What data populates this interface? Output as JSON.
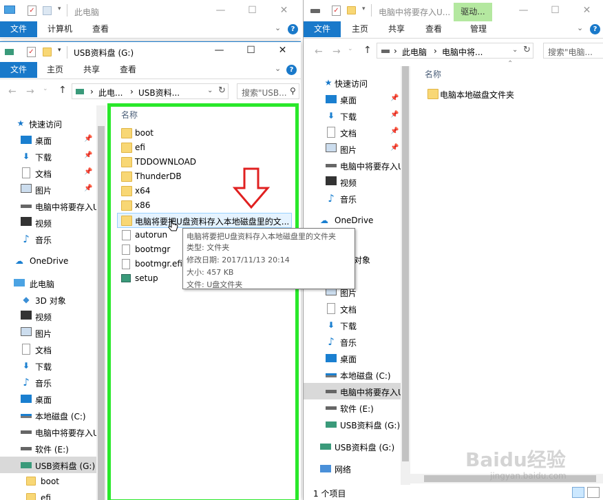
{
  "colors": {
    "accent": "#1979ca",
    "highlight": "#29e82a",
    "selection": "#cce8ff",
    "arrow": "#e02020",
    "drive_tab": "#b4e8a0"
  },
  "back_window": {
    "title": "此电脑",
    "tabs": [
      "文件",
      "计算机",
      "查看"
    ]
  },
  "usb_window": {
    "title": "USB资料盘 (G:)",
    "tabs": [
      "文件",
      "主页",
      "共享",
      "查看"
    ],
    "address": [
      "此电...",
      "USB资料..."
    ],
    "search_placeholder": "搜索\"USB...",
    "column_header": "名称",
    "nav": {
      "quick_access": "快速访问",
      "quick_items": [
        "桌面",
        "下载",
        "文档",
        "图片",
        "电脑中将要存入U",
        "视频",
        "音乐"
      ],
      "onedrive": "OneDrive",
      "this_pc": "此电脑",
      "pc_items": [
        "3D 对象",
        "视频",
        "图片",
        "文档",
        "下载",
        "音乐",
        "桌面",
        "本地磁盘 (C:)",
        "电脑中将要存入U",
        "软件 (E:)",
        "USB资料盘 (G:)",
        "boot",
        "efi"
      ]
    },
    "files": [
      "boot",
      "efi",
      "TDDOWNLOAD",
      "ThunderDB",
      "x64",
      "x86",
      "电脑将要把U盘资料存入本地磁盘里的文...",
      "autorun",
      "bootmgr",
      "bootmgr.efi",
      "setup"
    ],
    "tooltip": [
      "电脑将要把U盘资料存入本地磁盘里的文件夹",
      "类型: 文件夹",
      "修改日期: 2017/11/13 20:14",
      "大小: 457 KB",
      "文件: U盘文件夹"
    ]
  },
  "right_window": {
    "title": "电脑中将要存入U...",
    "context_tab": "驱动...",
    "tabs": [
      "文件",
      "主页",
      "共享",
      "查看",
      "管理"
    ],
    "address": [
      "此电脑",
      "电脑中将..."
    ],
    "search_placeholder": "搜索\"电脑...",
    "column_header": "名称",
    "nav": [
      "快速访问",
      "桌面",
      "下载",
      "文档",
      "图片",
      "电脑中将要存入U",
      "视频",
      "音乐",
      "OneDrive",
      "",
      "对象",
      "",
      "图片",
      "文档",
      "下载",
      "音乐",
      "桌面",
      "本地磁盘 (C:)",
      "电脑中将要存入U",
      "软件 (E:)",
      "USB资料盘 (G:)",
      "USB资料盘 (G:)",
      "网络"
    ],
    "files": [
      "电脑本地磁盘文件夹"
    ],
    "status": "1 个项目"
  },
  "watermark": [
    "Baidu经验",
    "jingyan.baidu.com"
  ]
}
